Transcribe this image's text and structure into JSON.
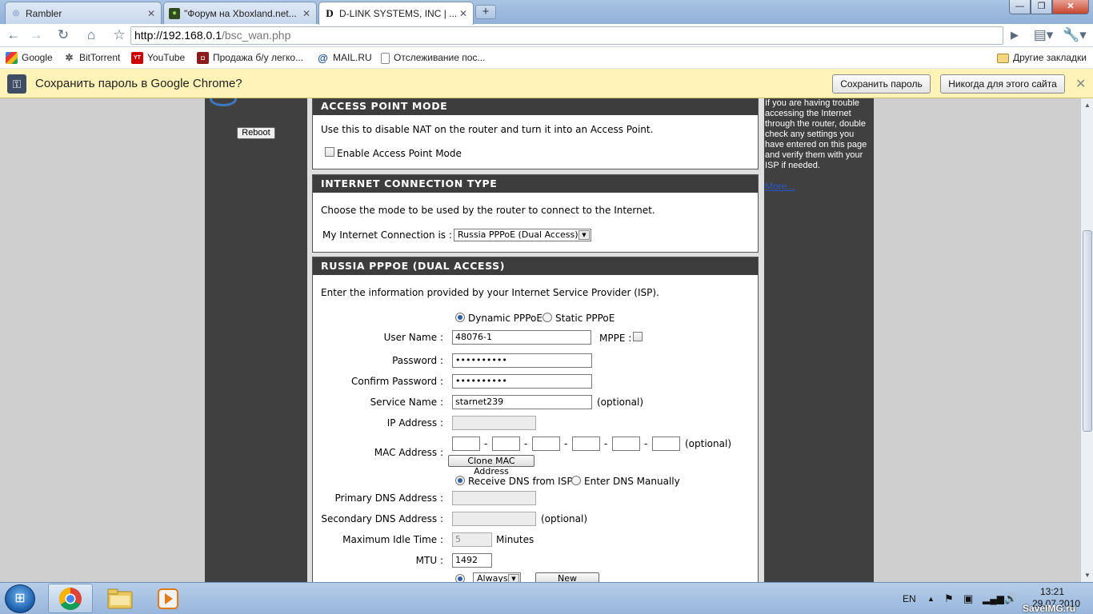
{
  "tabs": [
    {
      "label": "Rambler",
      "icon": "rambler-icon"
    },
    {
      "label": "\"Форум на Xboxland.net...",
      "icon": "xboxland-icon"
    },
    {
      "label": "D-LINK SYSTEMS, INC | ...",
      "icon": "dlink-icon"
    }
  ],
  "window_buttons": {
    "minimize": "—",
    "maximize": "❐",
    "close": "✕"
  },
  "toolbar": {
    "url_host": "http://192.168.0.1",
    "url_path": "/bsc_wan.php"
  },
  "bookmarks": [
    {
      "label": "Google",
      "icon": "google-icon"
    },
    {
      "label": "BitTorrent",
      "icon": "bittorrent-icon"
    },
    {
      "label": "YouTube",
      "icon": "youtube-icon"
    },
    {
      "label": "Продажа б/у легко...",
      "icon": "avito-icon"
    },
    {
      "label": "MAIL.RU",
      "icon": "mailru-icon"
    },
    {
      "label": "Отслеживание пос...",
      "icon": "page-icon"
    }
  ],
  "other_bookmarks": "Другие закладки",
  "infobar": {
    "message": "Сохранить пароль в Google Chrome?",
    "save_button": "Сохранить пароль",
    "never_button": "Никогда для этого сайта"
  },
  "leftnav": {
    "reboot_label": "Reboot"
  },
  "ap_mode": {
    "header": "ACCESS POINT MODE",
    "desc": "Use this to disable NAT on the router and turn it into an Access Point.",
    "checkbox_label": "Enable Access Point Mode"
  },
  "conn_type": {
    "header": "INTERNET CONNECTION TYPE",
    "desc": "Choose the mode to be used by the router to connect to the Internet.",
    "select_label": "My Internet Connection is :",
    "selected": "Russia PPPoE (Dual Access)"
  },
  "pppoe": {
    "header": "RUSSIA PPPOE (DUAL ACCESS)",
    "desc": "Enter the information provided by your Internet Service Provider (ISP).",
    "dynamic_label": "Dynamic PPPoE",
    "static_label": "Static PPPoE",
    "username_label": "User Name :",
    "username_value": "48076-1",
    "mppe_label": "MPPE :",
    "password_label": "Password :",
    "password_value": "••••••••••",
    "confirm_label": "Confirm Password :",
    "confirm_value": "••••••••••",
    "service_label": "Service Name :",
    "service_value": "starnet239",
    "optional": "(optional)",
    "ip_label": "IP Address :",
    "mac_label": "MAC Address :",
    "mac_sep": "-",
    "clone_mac": "Clone MAC Address",
    "dns_isp_label": "Receive DNS from ISP",
    "dns_manual_label": "Enter DNS Manually",
    "primary_dns_label": "Primary DNS Address :",
    "secondary_dns_label": "Secondary DNS Address :",
    "idle_label": "Maximum Idle Time :",
    "idle_value": "5",
    "minutes": "Minutes",
    "mtu_label": "MTU :",
    "mtu_value": "1492",
    "always_label": "Always",
    "new_schedule": "New Schedule"
  },
  "help": {
    "text": "If you are having trouble accessing the Internet through the router, double check any settings you have entered on this page and verify them with your ISP if needed.",
    "more": "More..."
  },
  "taskbar": {
    "lang": "EN",
    "time": "13:21",
    "date": "29.07.2010"
  },
  "watermark": "SaveIMG.ru"
}
